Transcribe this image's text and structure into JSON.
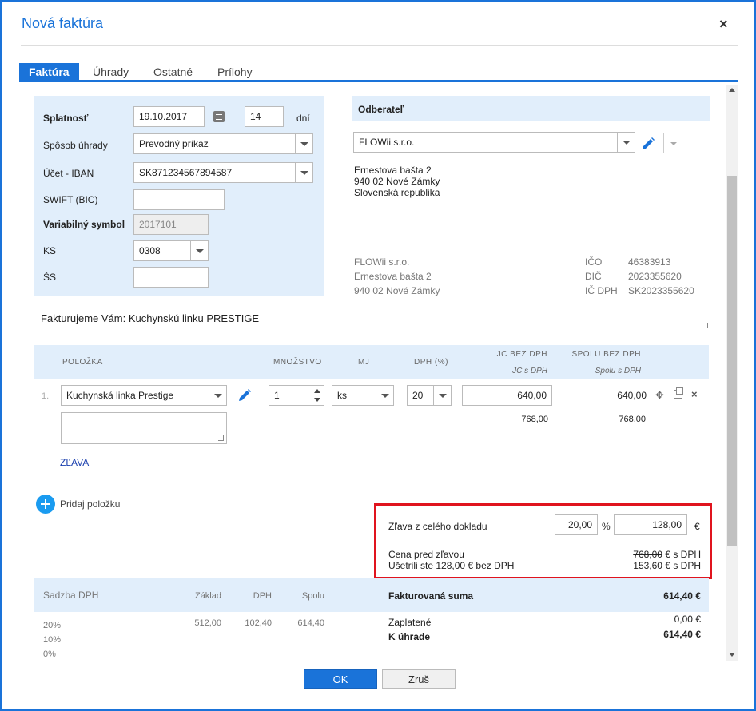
{
  "dialog": {
    "title": "Nová faktúra",
    "close": "×"
  },
  "tabs": [
    {
      "label": "Faktúra",
      "active": true
    },
    {
      "label": "Úhrady",
      "active": false
    },
    {
      "label": "Ostatné",
      "active": false
    },
    {
      "label": "Prílohy",
      "active": false
    }
  ],
  "payment": {
    "splatnost_label": "Splatnosť",
    "splatnost_value": "19.10.2017",
    "days_value": "14",
    "days_label": "dní",
    "method_label": "Spôsob úhrady",
    "method_value": "Prevodný príkaz",
    "iban_label": "Účet - IBAN",
    "iban_value": "SK871234567894587",
    "swift_label": "SWIFT (BIC)",
    "swift_value": "",
    "vs_label": "Variabilný symbol",
    "vs_value": "2017101",
    "ks_label": "KS",
    "ks_value": "0308",
    "ss_label": "ŠS",
    "ss_value": ""
  },
  "customer": {
    "header": "Odberateľ",
    "selected": "FLOWii s.r.o.",
    "address": [
      "Ernestova bašta 2",
      "940 02 Nové Zámky",
      "Slovenská republika"
    ],
    "supplier_lines": [
      "FLOWii s.r.o.",
      "Ernestova bašta 2",
      "940 02 Nové Zámky"
    ],
    "ids": [
      {
        "label": "IČO",
        "value": "46383913"
      },
      {
        "label": "DIČ",
        "value": "2023355620"
      },
      {
        "label": "IČ DPH",
        "value": "SK2023355620"
      }
    ]
  },
  "intro_text": "Fakturujeme Vám: Kuchynskú linku PRESTIGE",
  "items_table": {
    "headers": {
      "item": "POLOŽKA",
      "qty": "MNOŽSTVO",
      "unit": "MJ",
      "vat": "DPH (%)",
      "price_net": "JC BEZ DPH",
      "price_gross": "JC s DPH",
      "total_net": "SPOLU BEZ DPH",
      "total_gross": "Spolu s DPH"
    },
    "rows": [
      {
        "index": "1.",
        "name": "Kuchynská linka Prestige",
        "qty": "1",
        "unit": "ks",
        "vat": "20",
        "price_net": "640,00",
        "price_gross": "768,00",
        "total_net": "640,00",
        "total_gross": "768,00",
        "discount_link": "ZĽAVA"
      }
    ],
    "add_item": "Pridaj položku"
  },
  "discount": {
    "label": "Zľava z celého dokladu",
    "percent_value": "20,00",
    "percent_sign": "%",
    "amount_value": "128,00",
    "currency": "€",
    "before_label": "Cena pred zľavou",
    "before_value": "768,00",
    "before_suffix": "€ s DPH",
    "saved_label": "Ušetrili ste 128,00 € bez DPH",
    "saved_value": "153,60 € s DPH"
  },
  "vat_summary": {
    "headers": {
      "rate": "Sadzba DPH",
      "base": "Základ",
      "vat": "DPH",
      "total": "Spolu"
    },
    "rows": [
      {
        "rate": "20%",
        "base": "512,00",
        "vat": "102,40",
        "total": "614,40"
      },
      {
        "rate": "10%",
        "base": "",
        "vat": "",
        "total": ""
      },
      {
        "rate": "0%",
        "base": "",
        "vat": "",
        "total": ""
      }
    ]
  },
  "totals": {
    "invoiced_label": "Fakturovaná suma",
    "invoiced_value": "614,40 €",
    "paid_label": "Zaplatené",
    "paid_value": "0,00 €",
    "due_label": "K úhrade",
    "due_value": "614,40 €"
  },
  "buttons": {
    "ok": "OK",
    "cancel": "Zruš"
  },
  "colors": {
    "accent": "#1a73d9",
    "panel": "#e1eefb",
    "highlight": "#e0141e"
  }
}
